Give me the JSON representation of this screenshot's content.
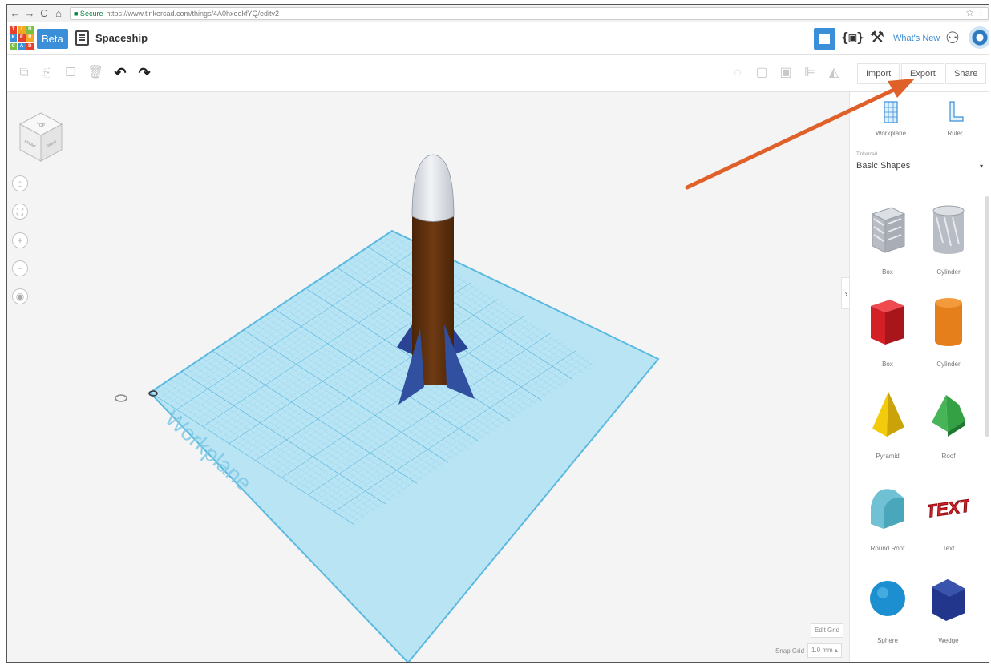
{
  "browser": {
    "back": "←",
    "forward": "→",
    "reload": "C",
    "home": "⌂",
    "secure": "■ Secure",
    "url": "https://www.tinkercad.com/things/4A0hxeokfYQ/editv2",
    "star": "☆",
    "menu": "⋮"
  },
  "header": {
    "logo_letters": [
      "T",
      "I",
      "N",
      "K",
      "E",
      "R",
      "C",
      "A",
      "D"
    ],
    "logo_colors": [
      "#e8402a",
      "#f5a623",
      "#7ac143",
      "#3b8fd9",
      "#e8402a",
      "#f5a623",
      "#7ac143",
      "#3b8fd9",
      "#e8402a"
    ],
    "beta": "Beta",
    "project_title": "Spaceship",
    "code_blocks": "{▣}",
    "hammer": "⚒",
    "whats_new": "What's New",
    "add_user": "⚇"
  },
  "toolbar": {
    "copy": "⧉",
    "paste": "⎘",
    "duplicate": "⧠",
    "delete": "🗑",
    "undo": "↶",
    "redo": "↷",
    "light": "◌",
    "group": "▢",
    "ungroup": "▣",
    "align": "⊫",
    "mirror": "◭",
    "import": "Import",
    "export": "Export",
    "share": "Share"
  },
  "viewport": {
    "cube_top": "TOP",
    "cube_front": "FRONT",
    "cube_right": "RIGHT",
    "home_view": "⌂",
    "fit_view": "⛶",
    "zoom_in": "+",
    "zoom_out": "−",
    "ortho": "◉",
    "workplane_label": "Workplane",
    "edit_grid": "Edit Grid",
    "snap_grid_label": "Snap Grid",
    "snap_grid_value": "1.0 mm ▴"
  },
  "panel": {
    "collapse": "›",
    "workplane": "Workplane",
    "ruler": "Ruler",
    "library_provider": "Tinkercad",
    "library_name": "Basic Shapes",
    "library_caret": "▾",
    "shapes": [
      {
        "label": "Box",
        "color": "#b8bcc4"
      },
      {
        "label": "Cylinder",
        "color": "#b8bcc4"
      },
      {
        "label": "Box",
        "color": "#d32027"
      },
      {
        "label": "Cylinder",
        "color": "#e57f1b"
      },
      {
        "label": "Pyramid",
        "color": "#f2cb0c"
      },
      {
        "label": "Roof",
        "color": "#33a144"
      },
      {
        "label": "Round Roof",
        "color": "#6fc1d3"
      },
      {
        "label": "Text",
        "color": "#d32027"
      },
      {
        "label": "Sphere",
        "color": "#1b8fd0"
      },
      {
        "label": "Wedge",
        "color": "#22378c"
      }
    ]
  },
  "colors": {
    "accent": "#3b8fd9",
    "workplane": "#9fd8ef",
    "rocket_body": "#5b2e0c",
    "rocket_nose": "#d7dbe0",
    "rocket_fins": "#2f4c9f",
    "arrow": "#e0602a"
  }
}
